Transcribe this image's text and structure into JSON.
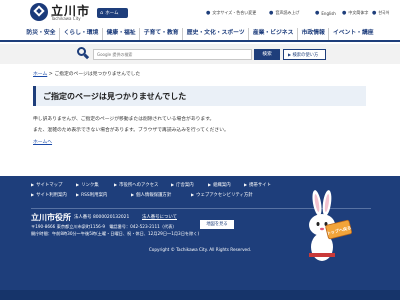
{
  "header": {
    "site_name": "立川市",
    "site_name_en": "Tachikawa City",
    "home_label": "ホーム",
    "links": [
      {
        "label": "文字サイズ・色合い変更"
      },
      {
        "label": "音声読み上げ"
      },
      {
        "label": "English"
      },
      {
        "label": "中文简体字"
      },
      {
        "label": "한국어"
      }
    ]
  },
  "nav": {
    "items": [
      {
        "label": "防災・安全"
      },
      {
        "label": "くらし・環境"
      },
      {
        "label": "健康・福祉"
      },
      {
        "label": "子育て・教育"
      },
      {
        "label": "歴史・文化・スポーツ"
      },
      {
        "label": "産業・ビジネス"
      },
      {
        "label": "市政情報"
      },
      {
        "label": "イベント・講座"
      }
    ]
  },
  "search": {
    "placeholder": "Google 提供の検索",
    "button_label": "検索",
    "howto_label": "検索の使い方"
  },
  "breadcrumb": {
    "home": "ホーム",
    "separator": ">",
    "current": "ご指定のページは見つかりませんでした"
  },
  "main": {
    "title": "ご指定のページは見つかりませんでした",
    "message_1": "申し訳ありませんが、ご指定のページが移動または削除されている場合があります。",
    "message_2": "また、混雑のため表示できない場合があります。ブラウザで再読み込みを行ってください。",
    "home_link": "ホームへ"
  },
  "footer": {
    "links": [
      {
        "label": "サイトマップ"
      },
      {
        "label": "リンク集"
      },
      {
        "label": "市役所へのアクセス"
      },
      {
        "label": "庁舎案内"
      },
      {
        "label": "組織案内"
      },
      {
        "label": "携帯サイト"
      },
      {
        "label": "サイト利用案内"
      },
      {
        "label": "RSS利用案内"
      },
      {
        "label": "個人情報保護方針"
      },
      {
        "label": "ウェブアクセシビリティ方針"
      }
    ],
    "office_name": "立川市役所",
    "corp_number": "法人番号 8000020132021",
    "corp_link": "法人番号について",
    "address": "〒190-8666 東京都立川市泉町1156-9　電話番号：042-523-2111（代表）",
    "hours": "開庁時間：午前8時30分〜午後5時(土曜・日曜日、祝・休日、12月29日〜1月3日を除く)",
    "access_label": "地図を見る",
    "copyright": "Copyright © Tachikawa City. All Rights Reserved.",
    "mascot_sign": "トップへ戻る"
  },
  "colors": {
    "primary": "#1e3e7b",
    "footer_bg": "#1e3e7b",
    "title_bg": "#eaf0f7",
    "link": "#1a4aa8"
  }
}
